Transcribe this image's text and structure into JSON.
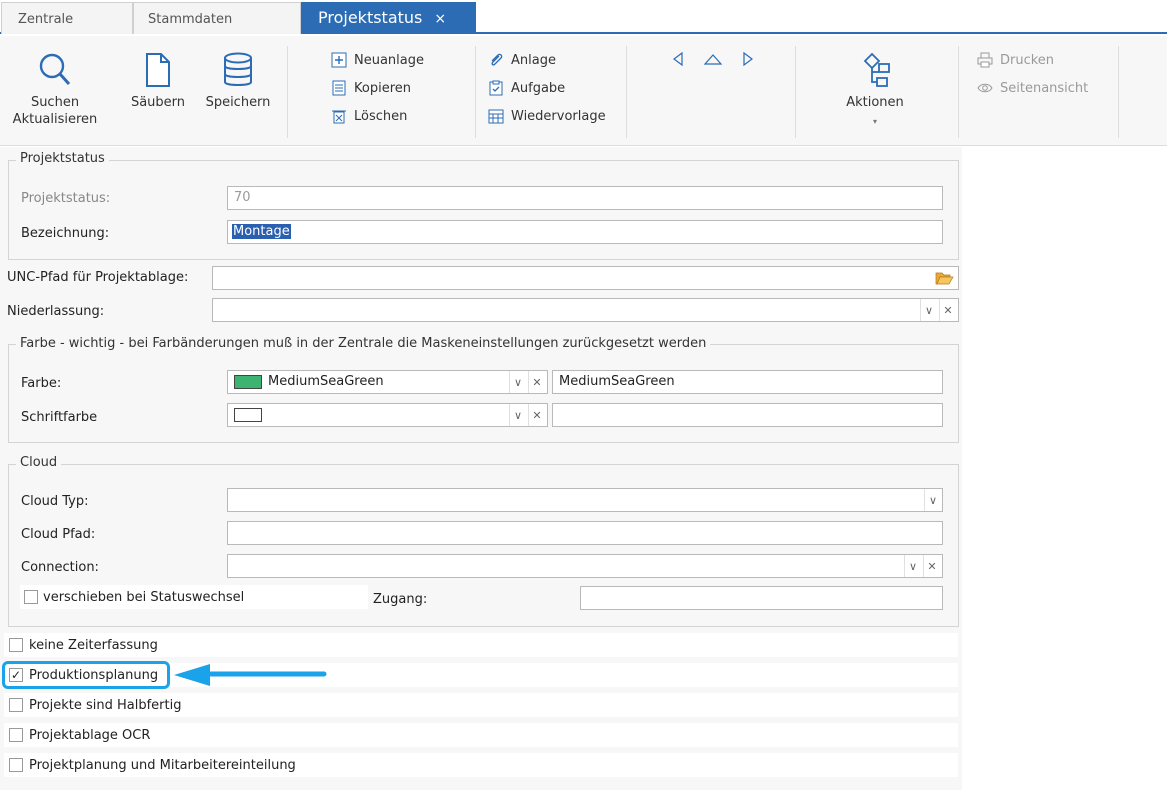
{
  "tabs": [
    {
      "label": "Zentrale"
    },
    {
      "label": "Stammdaten"
    },
    {
      "label": "Projektstatus",
      "close": "×"
    }
  ],
  "ribbon": {
    "search_label": "Suchen",
    "refresh_label": "Aktualisieren",
    "clear_label": "Säubern",
    "save_label": "Speichern",
    "new_label": "Neuanlage",
    "copy_label": "Kopieren",
    "delete_label": "Löschen",
    "attach_label": "Anlage",
    "task_label": "Aufgabe",
    "followup_label": "Wiedervorlage",
    "actions_label": "Aktionen",
    "print_label": "Drucken",
    "preview_label": "Seitenansicht"
  },
  "projektstatus_group": {
    "legend": "Projektstatus",
    "status_label": "Projektstatus:",
    "status_value": "70",
    "name_label": "Bezeichnung:",
    "name_value": "Montage"
  },
  "unc": {
    "label": "UNC-Pfad für Projektablage:",
    "value": ""
  },
  "branch": {
    "label": "Niederlassung:",
    "value": ""
  },
  "color_group": {
    "legend": "Farbe - wichtig - bei Farbänderungen muß in der Zentrale die Maskeneinstellungen zurückgesetzt werden",
    "color_label": "Farbe:",
    "color_value": "MediumSeaGreen",
    "color_text": "MediumSeaGreen",
    "color_hex": "#3cb371",
    "font_color_label": "Schriftfarbe",
    "font_color_hex": "#ffffff",
    "font_color_text": ""
  },
  "cloud_group": {
    "legend": "Cloud",
    "type_label": "Cloud Typ:",
    "path_label": "Cloud Pfad:",
    "connection_label": "Connection:",
    "move_label": "verschieben bei Statuswechsel",
    "access_label": "Zugang:"
  },
  "options": [
    {
      "label": "keine Zeiterfassung",
      "checked": false
    },
    {
      "label": "Produktionsplanung",
      "checked": true
    },
    {
      "label": "Projekte sind Halbfertig",
      "checked": false
    },
    {
      "label": "Projektablage OCR",
      "checked": false
    },
    {
      "label": "Projektplanung und Mitarbeitereinteilung",
      "checked": false
    }
  ],
  "highlight_color": "#1aa3e8",
  "accent_color": "#2b6cb5"
}
